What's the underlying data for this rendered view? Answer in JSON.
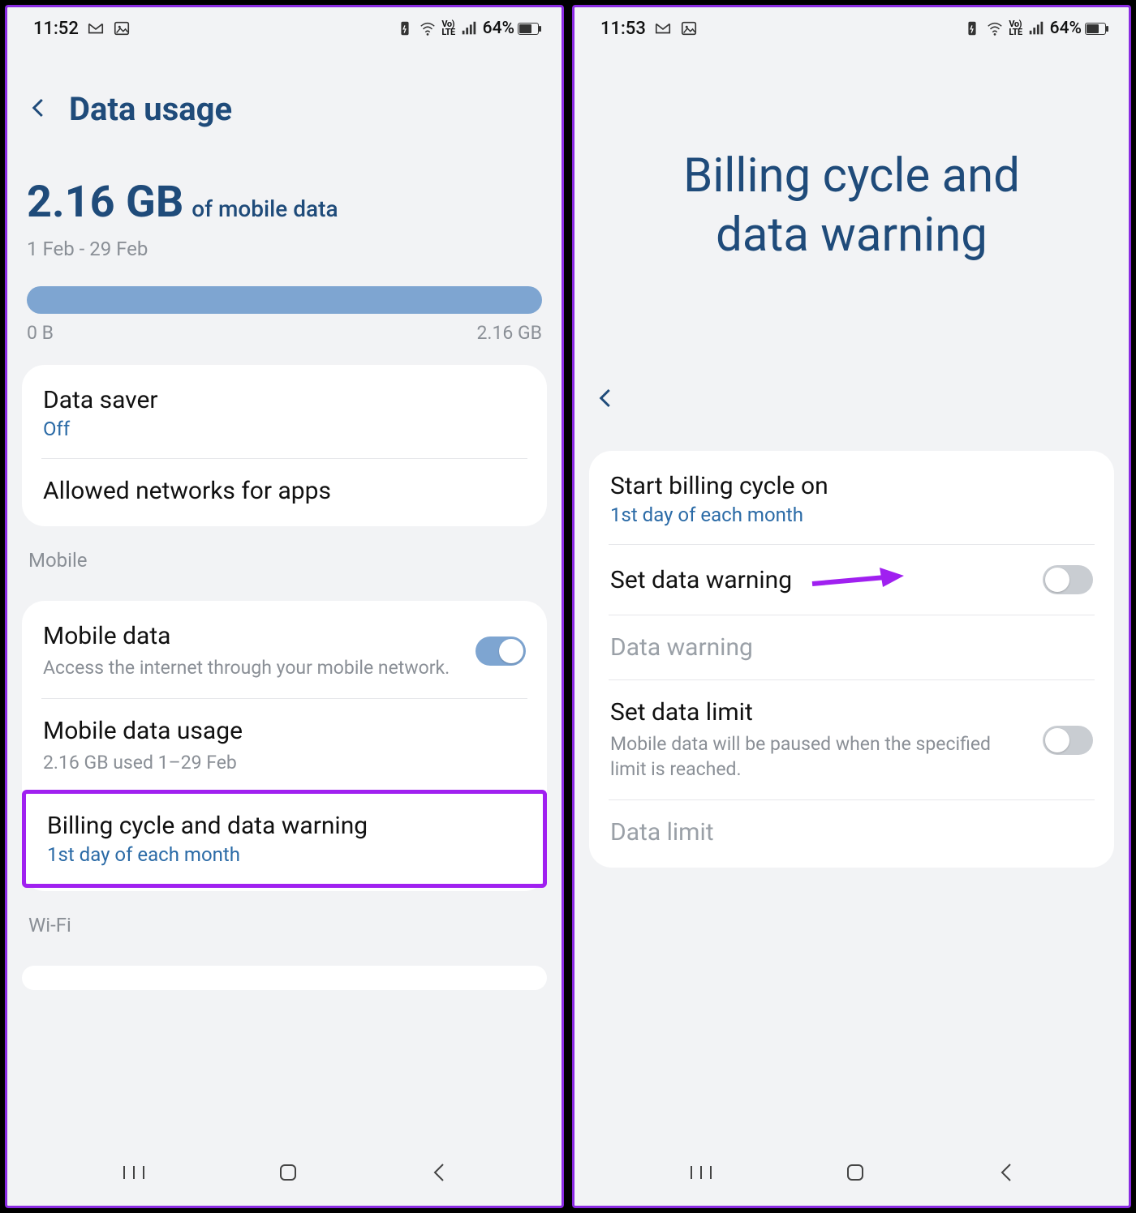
{
  "left": {
    "status": {
      "time": "11:52",
      "battery_pct": "64%"
    },
    "header": {
      "title": "Data usage"
    },
    "usage": {
      "amount": "2.16 GB",
      "suffix": "of mobile data",
      "period": "1 Feb - 29 Feb",
      "bar_min": "0 B",
      "bar_max": "2.16 GB"
    },
    "card1": {
      "data_saver_title": "Data saver",
      "data_saver_status": "Off",
      "allowed_networks_title": "Allowed networks for apps"
    },
    "section_mobile": "Mobile",
    "card2": {
      "mobile_data_title": "Mobile data",
      "mobile_data_desc": "Access the internet through your mobile network.",
      "mobile_data_usage_title": "Mobile data usage",
      "mobile_data_usage_sub": "2.16 GB used 1–29 Feb",
      "billing_title": "Billing cycle and data warning",
      "billing_sub": "1st day of each month"
    },
    "section_wifi": "Wi-Fi"
  },
  "right": {
    "status": {
      "time": "11:53",
      "battery_pct": "64%"
    },
    "big_title_line1": "Billing cycle and",
    "big_title_line2": "data warning",
    "card": {
      "start_cycle_title": "Start billing cycle on",
      "start_cycle_sub": "1st day of each month",
      "set_warning_title": "Set data warning",
      "data_warning_title": "Data warning",
      "set_limit_title": "Set data limit",
      "set_limit_desc": "Mobile data will be paused when the specified limit is reached.",
      "data_limit_title": "Data limit"
    }
  }
}
